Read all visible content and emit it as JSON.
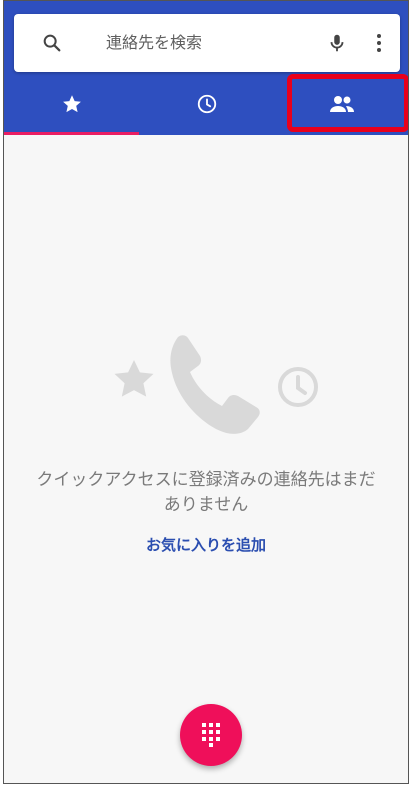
{
  "search": {
    "placeholder": "連絡先を検索",
    "icons": [
      "search-icon",
      "mic-icon",
      "more-vert-icon"
    ]
  },
  "tabs": [
    {
      "name": "favorites",
      "icon": "star-icon",
      "selected": true
    },
    {
      "name": "recents",
      "icon": "clock-icon",
      "selected": false
    },
    {
      "name": "contacts",
      "icon": "people-icon",
      "selected": false,
      "highlighted": true
    }
  ],
  "empty_state": {
    "message_line1": "クイックアクセスに登録済みの連絡先はまだ",
    "message_line2": "ありません",
    "action_label": "お気に入りを追加"
  },
  "fab": {
    "icon": "dialpad-icon"
  },
  "colors": {
    "header_blue": "#2e4fbf",
    "tab_indicator": "#e91e63",
    "fab_pink": "#ef0f5a",
    "highlight_red": "#e8001c",
    "link_blue": "#2b4eb0"
  }
}
